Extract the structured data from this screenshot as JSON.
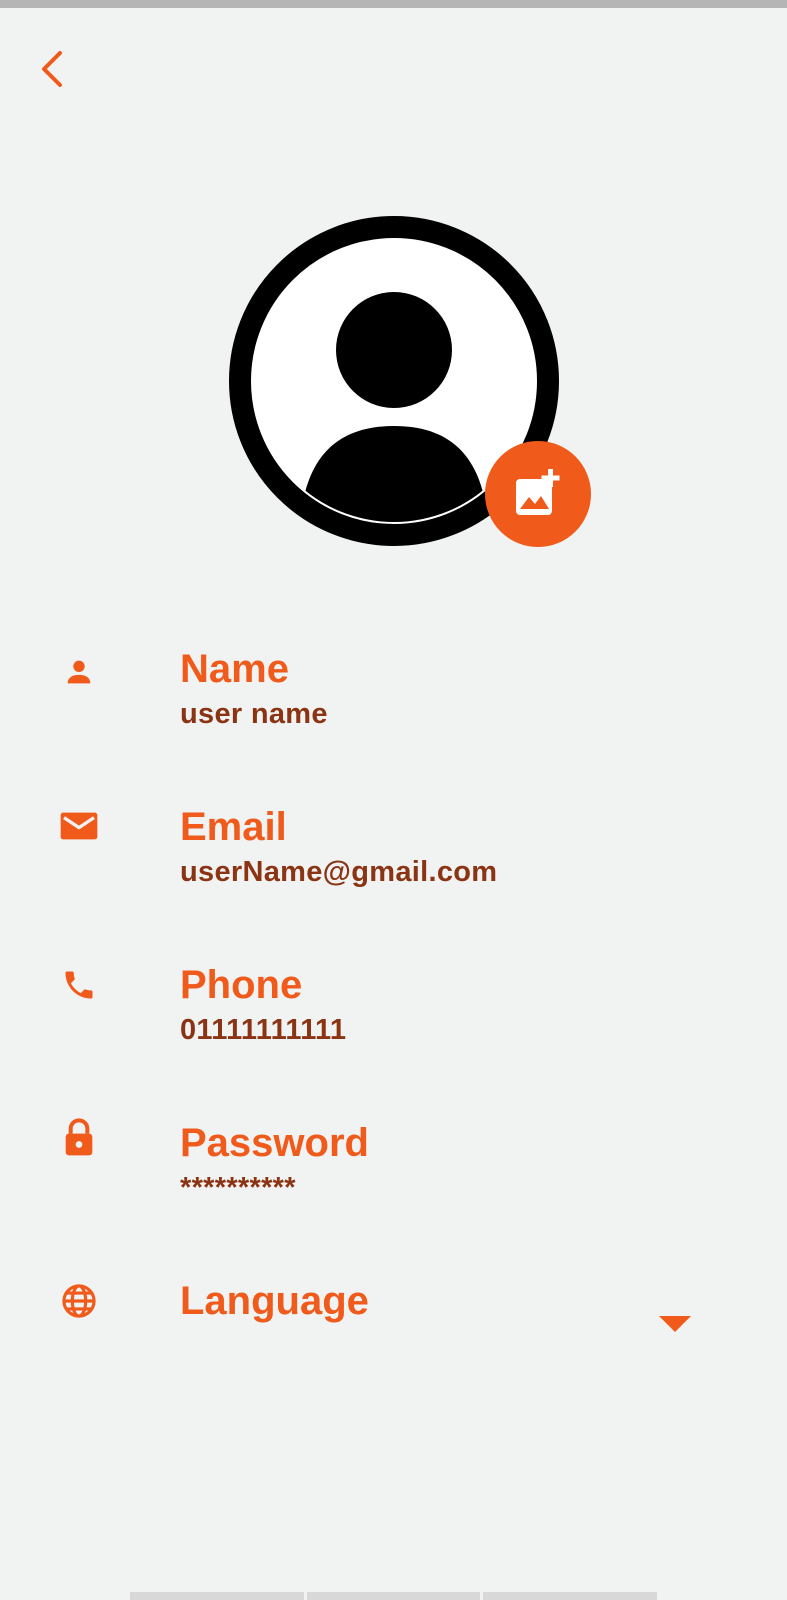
{
  "theme": {
    "accent": "#f05a1a",
    "value_color": "#8a3413",
    "background": "#f1f2f2"
  },
  "header": {
    "back_icon": "chevron-left-icon"
  },
  "avatar": {
    "icon": "user-avatar-icon",
    "add_photo_icon": "add-photo-icon"
  },
  "fields": {
    "name": {
      "icon": "person-icon",
      "label": "Name",
      "value": "user name"
    },
    "email": {
      "icon": "mail-icon",
      "label": "Email",
      "value": "userName@gmail.com"
    },
    "phone": {
      "icon": "phone-icon",
      "label": "Phone",
      "value": "01111111111"
    },
    "password": {
      "icon": "lock-icon",
      "label": "Password",
      "value": "**********"
    },
    "language": {
      "icon": "globe-icon",
      "label": "Language",
      "dropdown_icon": "caret-down-icon"
    }
  }
}
